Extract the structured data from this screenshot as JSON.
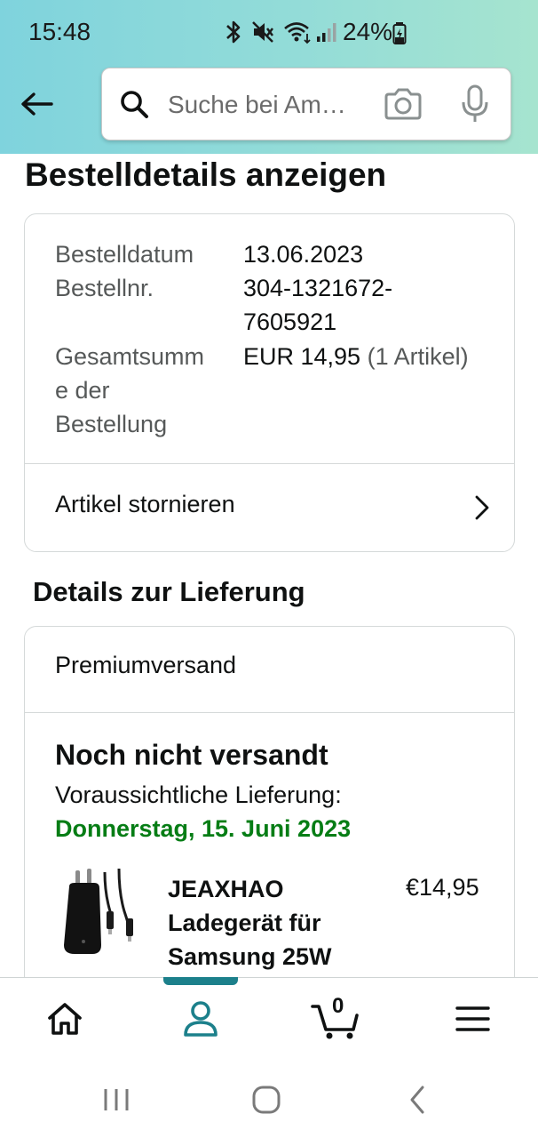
{
  "status_bar": {
    "time": "15:48",
    "battery": "24%"
  },
  "search": {
    "placeholder": "Suche bei Am…"
  },
  "page": {
    "title": "Bestelldetails anzeigen"
  },
  "order_summary": {
    "date_label": "Bestelldatum",
    "date_value": "13.06.2023",
    "number_label": "Bestellnr.",
    "number_value_line1": "304-1321672-",
    "number_value_line2": "7605921",
    "total_label_line1": "Gesamtsumm",
    "total_label_line2": "e der",
    "total_label_line3": "Bestellung",
    "total_amount": "EUR 14,95",
    "total_items": "(1 Artikel)",
    "cancel_label": "Artikel stornieren"
  },
  "delivery": {
    "section_title": "Details zur Lieferung",
    "method": "Premiumversand",
    "status": "Noch nicht versandt",
    "eta_label": "Voraussichtliche Lieferung:",
    "eta_date": "Donnerstag, 15. Juni 2023",
    "product": {
      "name_line1": "JEAXHAO",
      "name_line2": "Ladegerät für",
      "name_line3": "Samsung 25W",
      "price": "€14,95"
    }
  },
  "bottom_nav": {
    "cart_count": "0",
    "active_tab": "account",
    "accent_color": "#1c808b"
  },
  "colors": {
    "delivery_date": "#067d15",
    "header_gradient_start": "#7fd3dd",
    "header_gradient_end": "#a6e4cf"
  },
  "icons": [
    "back-arrow-icon",
    "search-icon",
    "camera-icon",
    "microphone-icon",
    "chevron-right-icon",
    "home-icon",
    "account-icon",
    "cart-icon",
    "menu-icon"
  ]
}
